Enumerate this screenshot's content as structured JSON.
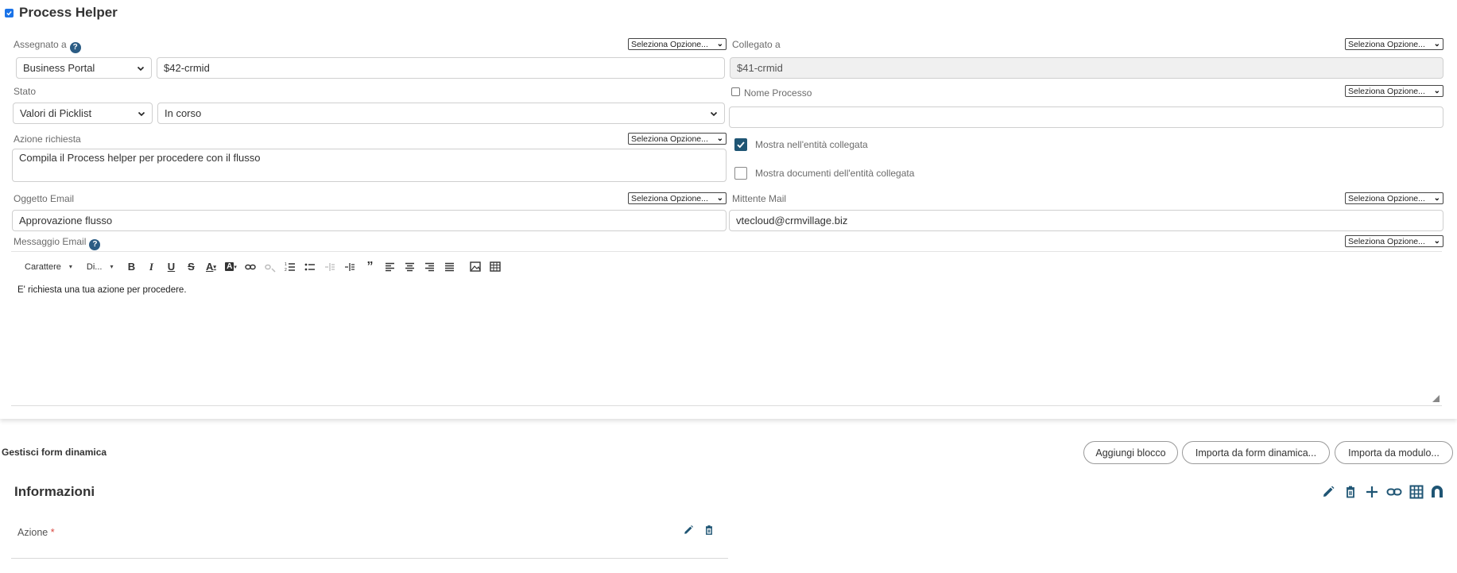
{
  "header": {
    "title": "Process Helper",
    "enabled": true
  },
  "option_label": "Seleziona Opzione...",
  "assigned": {
    "label": "Assegnato a",
    "type_value": "Business Portal",
    "value": "$42-crmid"
  },
  "linked": {
    "label": "Collegato a",
    "value": "$41-crmid"
  },
  "status": {
    "label": "Stato",
    "type_value": "Valori di Picklist",
    "value": "In corso"
  },
  "process_name": {
    "label": "Nome Processo",
    "value": ""
  },
  "required_action": {
    "label": "Azione richiesta",
    "value": "Compila il Process helper per procedere con il flusso"
  },
  "checks": {
    "show_in_linked": {
      "label": "Mostra nell'entità collegata",
      "checked": true
    },
    "show_docs": {
      "label": "Mostra documenti dell'entità collegata",
      "checked": false
    }
  },
  "email_subject": {
    "label": "Oggetto Email",
    "value": "Approvazione flusso"
  },
  "mail_sender": {
    "label": "Mittente Mail",
    "value": "vtecloud@crmvillage.biz"
  },
  "email_message": {
    "label": "Messaggio Email",
    "font_label": "Carattere",
    "size_label": "Di...",
    "body": "E' richiesta una tua azione per procedere."
  },
  "dynamic_form": {
    "title": "Gestisci form dinamica",
    "buttons": {
      "add_block": "Aggiungi blocco",
      "import_form": "Importa da form dinamica...",
      "import_module": "Importa da modulo..."
    },
    "block": {
      "title": "Informazioni",
      "field_label": "Azione",
      "required_mark": "*"
    }
  },
  "colors": {
    "accent": "#1f5574",
    "help": "#2b5c84",
    "required": "#d9463e"
  }
}
